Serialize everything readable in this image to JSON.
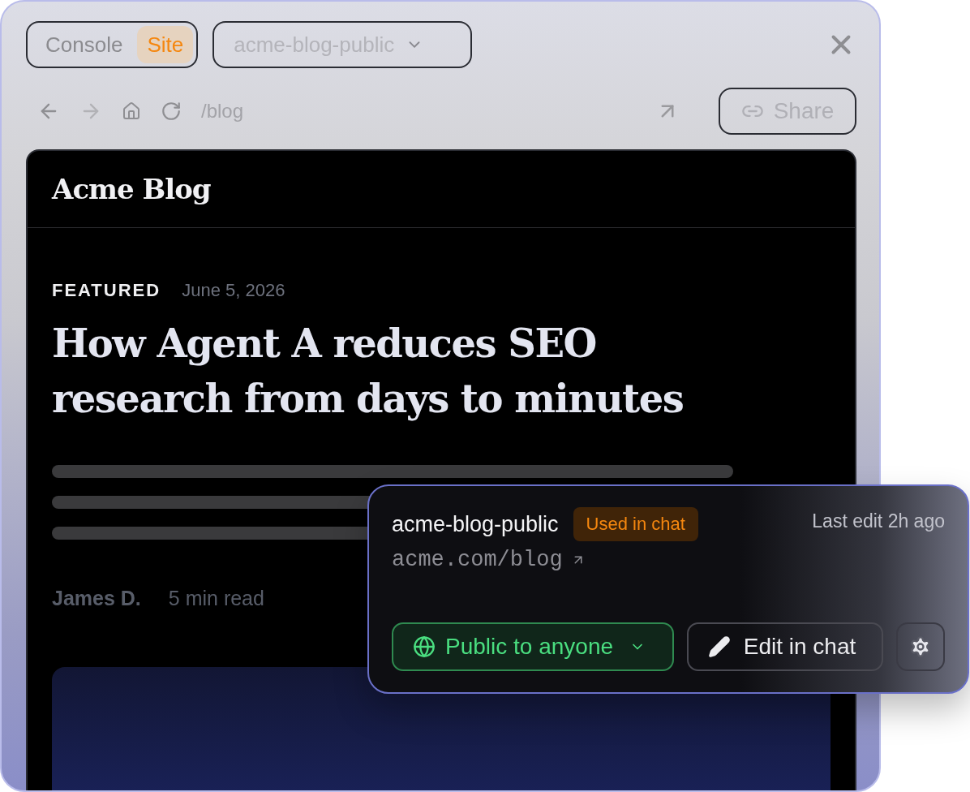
{
  "mode_tabs": [
    {
      "label": "Console",
      "selected": false
    },
    {
      "label": "Site",
      "selected": true
    }
  ],
  "site_select": {
    "value": "acme-blog-public"
  },
  "browser_bar": {
    "path": "/blog",
    "share_label": "Share"
  },
  "blog": {
    "title": "Acme Blog",
    "tag": "FEATURED",
    "date": "June 5, 2026",
    "headline": "How Agent A reduces SEO research from days to minutes",
    "author": "James D.",
    "read_time": "5 min read"
  },
  "popover": {
    "name": "acme-blog-public",
    "badge": "Used in chat",
    "last_edit": "Last edit 2h ago",
    "url": "acme.com/blog",
    "visibility": "Public to anyone",
    "edit_label": "Edit in chat"
  }
}
